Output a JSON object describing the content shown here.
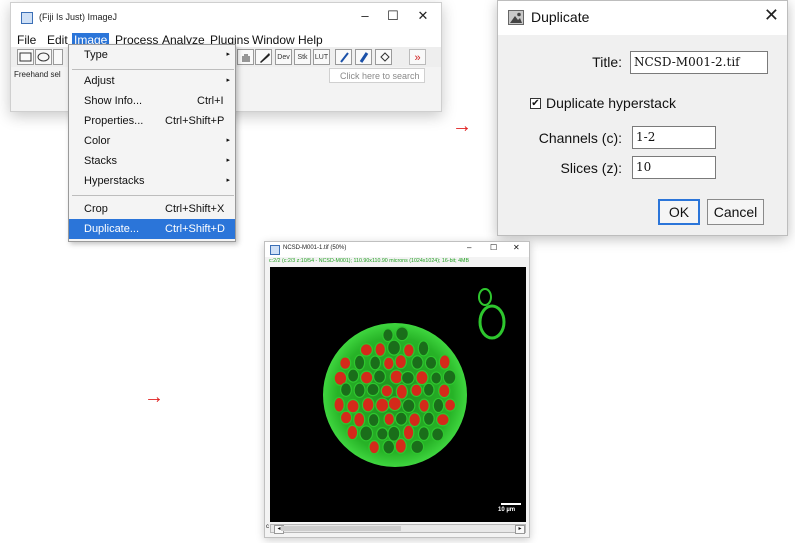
{
  "fiji": {
    "title": "(Fiji Is Just) ImageJ",
    "menubar": [
      "File",
      "Edit",
      "Image",
      "Process",
      "Analyze",
      "Plugins",
      "Window",
      "Help"
    ],
    "selected_menu": "Image",
    "toolbar_labels": [
      "Dev",
      "Stk",
      "LUT"
    ],
    "toolbar_more": "»",
    "status": "Freehand sel",
    "search_placeholder": "Click here to search",
    "window_controls": [
      "–",
      "☐",
      "✕"
    ]
  },
  "image_menu": {
    "items": [
      {
        "label": "Type",
        "shortcut": "",
        "submenu": true
      },
      {
        "label": "Adjust",
        "shortcut": "",
        "submenu": true
      },
      {
        "label": "Show Info...",
        "shortcut": "Ctrl+I",
        "submenu": false
      },
      {
        "label": "Properties...",
        "shortcut": "Ctrl+Shift+P",
        "submenu": false
      },
      {
        "label": "Color",
        "shortcut": "",
        "submenu": true
      },
      {
        "label": "Stacks",
        "shortcut": "",
        "submenu": true
      },
      {
        "label": "Hyperstacks",
        "shortcut": "",
        "submenu": true
      },
      {
        "label": "Crop",
        "shortcut": "Ctrl+Shift+X",
        "submenu": false
      },
      {
        "label": "Duplicate...",
        "shortcut": "Ctrl+Shift+D",
        "submenu": false
      }
    ],
    "selected": "Duplicate...",
    "submenu_glyph": "▸"
  },
  "arrow_glyph": "→",
  "duplicate_dialog": {
    "title": "Duplicate",
    "close_glyph": "✕",
    "title_label": "Title:",
    "title_value": "NCSD-M001-2.tif",
    "hyperstack_label": "Duplicate hyperstack",
    "hyperstack_checked": true,
    "check_glyph": "✔",
    "channels_label": "Channels (c):",
    "channels_value": "1-2",
    "slices_label": "Slices (z):",
    "slices_value": "10",
    "ok_label": "OK",
    "cancel_label": "Cancel"
  },
  "image_window": {
    "title": "NCSD-M001-1.tif (50%)",
    "controls": [
      "–",
      "☐",
      "✕"
    ],
    "info": "c:2/2 (c:2/3 z:10/54 - NCSD-M001); 110.90x110.90 microns (1024x1024); 16-bit; 4MB",
    "scalebar_label": "10 µm",
    "slider_channel_label": "c",
    "slider_left": "◂",
    "slider_right": "▸"
  },
  "colors": {
    "selection_blue": "#2b75d9",
    "arrow_red": "#e02020",
    "green_channel": "#2ec72e",
    "red_channel": "#d42a1a"
  }
}
